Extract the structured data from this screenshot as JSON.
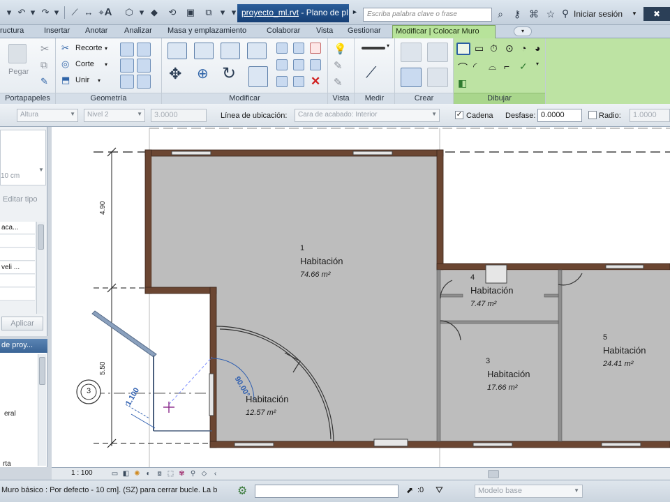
{
  "titlebar": {
    "document_name": "proyecto_ml.rvt",
    "document_rest": " - Plano de pl",
    "search_placeholder": "Escriba palabra clave o frase",
    "login_label": "Iniciar sesión",
    "quick_access_icons": [
      "open-icon",
      "undo-icon",
      "redo-icon",
      "measure-icon",
      "tag-icon",
      "text-icon",
      "3d-view-icon",
      "section-icon",
      "close-hidden-icon",
      "switch-windows-icon",
      "dropdown-icon"
    ]
  },
  "ribbon_tabs": [
    {
      "label": "ructura",
      "id": "tab-estructura"
    },
    {
      "label": "Insertar",
      "id": "tab-insertar"
    },
    {
      "label": "Anotar",
      "id": "tab-anotar"
    },
    {
      "label": "Analizar",
      "id": "tab-analizar"
    },
    {
      "label": "Masa y emplazamiento",
      "id": "tab-masa"
    },
    {
      "label": "Colaborar",
      "id": "tab-colaborar"
    },
    {
      "label": "Vista",
      "id": "tab-vista"
    },
    {
      "label": "Gestionar",
      "id": "tab-gestionar"
    }
  ],
  "active_tab": "Modificar | Colocar Muro",
  "ribbon": {
    "portapapeles": {
      "label": "Portapapeles",
      "paste_label": "Pegar"
    },
    "geometria": {
      "label": "Geometría",
      "recorte_label": "Recorte",
      "corte_label": "Corte",
      "unir_label": "Unir"
    },
    "modificar": {
      "label": "Modificar"
    },
    "vista": {
      "label": "Vista"
    },
    "medir": {
      "label": "Medir"
    },
    "crear": {
      "label": "Crear"
    },
    "dibujar": {
      "label": "Dibujar"
    }
  },
  "options_bar": {
    "altura_label": "Altura",
    "nivel_value": "Nivel 2",
    "height_value": "3.0000",
    "linea_label": "Línea de ubicación:",
    "linea_value": "Cara de acabado: Interior",
    "cadena_label": "Cadena",
    "cadena_checked": true,
    "desfase_label": "Desfase:",
    "desfase_value": "0.0000",
    "radio_label": "Radio:",
    "radio_checked": false,
    "radio_value": "1.0000"
  },
  "properties_panel": {
    "size_text": "10 cm",
    "edit_type_label": "Editar tipo",
    "rows": [
      "aca...",
      "",
      "",
      "veli ...",
      ""
    ],
    "apply_label": "Aplicar"
  },
  "project_browser": {
    "title": "de proy...",
    "items": [
      "eral",
      "rta"
    ]
  },
  "rooms": [
    {
      "number": "1",
      "name": "Habitación",
      "area": "74.66 m²"
    },
    {
      "number": "4",
      "name": "Habitación",
      "area": "7.47 m²"
    },
    {
      "number": "3",
      "name": "Habitación",
      "area": "17.66 m²"
    },
    {
      "number": "5",
      "name": "Habitación",
      "area": "24.41 m²"
    },
    {
      "number": "",
      "name": "Habitación",
      "area": "12.57 m²"
    }
  ],
  "dimensions": {
    "vertical_top": "4.90",
    "vertical_bottom": "5.50",
    "temp_length": "1.100",
    "angle_text": "90.00°"
  },
  "grid_bubble": "3",
  "view_bar": {
    "scale": "1 : 100"
  },
  "status_bar": {
    "message": "Muro básico : Por defecto - 10 cm]. (SZ) para cerrar bucle. La b",
    "zero_value": ":0",
    "model_value": "Modelo base"
  },
  "colors": {
    "active_tab": "#b7e39a",
    "doc_tab": "#1f4b86",
    "room_fill": "#bdbdbd",
    "wall": "#5a3a2a",
    "temp_dimension": "#2f5fb0"
  }
}
